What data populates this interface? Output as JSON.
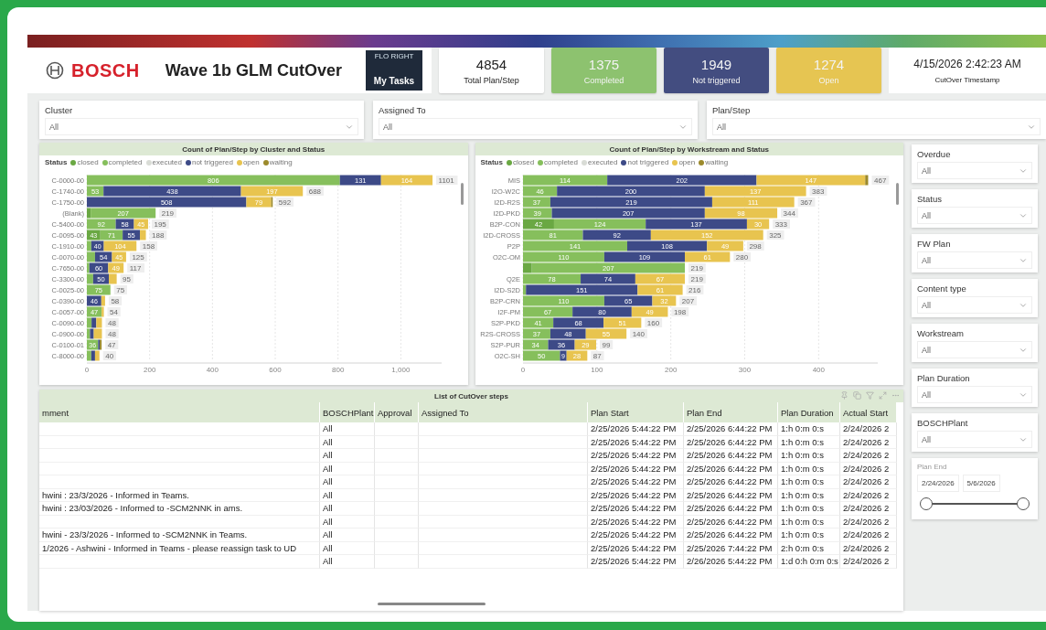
{
  "header": {
    "brand": "BOSCH",
    "title": "Wave 1b GLM CutOver",
    "tile": {
      "logo_text": "FLO RIGHT",
      "button": "My Tasks"
    }
  },
  "kpis": [
    {
      "value": "4854",
      "label": "Total Plan/Step",
      "color": "#ffffff"
    },
    {
      "value": "1375",
      "label": "Completed",
      "color": "#8dc26f"
    },
    {
      "value": "1949",
      "label": "Not triggered",
      "color": "#434d80"
    },
    {
      "value": "1274",
      "label": "Open",
      "color": "#e6c552"
    }
  ],
  "timestamp": {
    "value": "4/15/2026 2:42:23 AM",
    "label": "CutOver Timestamp"
  },
  "filters": [
    {
      "label": "Cluster",
      "value": "All"
    },
    {
      "label": "Assigned To",
      "value": "All"
    },
    {
      "label": "Plan/Step",
      "value": "All"
    }
  ],
  "charts": [
    {
      "legend_title": "Status",
      "totals": [
        "1101",
        "688",
        "592",
        "219",
        "195",
        "188",
        "158",
        "125",
        "117",
        "95",
        "75",
        "58",
        "54",
        "48",
        "48",
        "47",
        "40"
      ],
      "chart_data": {
        "type": "bar",
        "orientation": "horizontal",
        "stacked": true,
        "grid": true,
        "title": "Count of Plan/Step by Cluster and Status",
        "categories": [
          "C-0000-00",
          "C-1740-00",
          "C-1750-00",
          "(Blank)",
          "C-5400-00",
          "C-0095-00",
          "C-1910-00",
          "C-0070-00",
          "C-7650-00",
          "C-3300-00",
          "C-0025-00",
          "C-0390-00",
          "C-0057-00",
          "C-0090-00",
          "C-0900-00",
          "C-0100-01",
          "C-8000-00"
        ],
        "xlim": [
          0,
          1130
        ],
        "xticks": [
          0,
          200,
          400,
          600,
          800,
          {
            "value": 1000,
            "label": "1,000"
          }
        ],
        "series": [
          {
            "name": "closed",
            "color": "#6aa843",
            "values": [
              null,
              null,
              null,
              12,
              null,
              43,
              null,
              null,
              null,
              null,
              null,
              null,
              null,
              null,
              null,
              null,
              null
            ],
            "value_labels": [
              null,
              null,
              null,
              null,
              null,
              "43",
              null,
              null,
              null,
              null,
              null,
              null,
              null,
              null,
              null,
              null,
              null
            ]
          },
          {
            "name": "completed",
            "color": "#86bf5c",
            "values": [
              806,
              53,
              null,
              207,
              92,
              71,
              14,
              26,
              8,
              20,
              75,
              null,
              47,
              15,
              10,
              36,
              14
            ],
            "value_labels": [
              "806",
              "53",
              null,
              "207",
              "92",
              "71",
              null,
              null,
              null,
              null,
              "75",
              null,
              "47",
              null,
              null,
              "36",
              null
            ]
          },
          {
            "name": "executed",
            "color": "#d9dcd6",
            "values": [
              null,
              null,
              null,
              null,
              null,
              null,
              null,
              null,
              null,
              null,
              null,
              null,
              null,
              null,
              null,
              null,
              null
            ],
            "value_labels": [
              null,
              null,
              null,
              null,
              null,
              null,
              null,
              null,
              null,
              null,
              null,
              null,
              null,
              null,
              null,
              null,
              null
            ]
          },
          {
            "name": "not triggered",
            "color": "#3d4a87",
            "values": [
              131,
              438,
              508,
              null,
              58,
              55,
              40,
              54,
              60,
              50,
              null,
              46,
              null,
              15,
              12,
              5,
              12
            ],
            "value_labels": [
              "131",
              "438",
              "508",
              null,
              "58",
              "55",
              "40",
              "54",
              "60",
              "50",
              null,
              "46",
              null,
              null,
              null,
              null,
              null
            ]
          },
          {
            "name": "open",
            "color": "#e8c44f",
            "values": [
              164,
              197,
              79,
              null,
              45,
              19,
              104,
              45,
              49,
              25,
              null,
              12,
              7,
              18,
              26,
              null,
              14
            ],
            "value_labels": [
              "164",
              "197",
              "79",
              null,
              "45",
              null,
              "104",
              "45",
              "49",
              null,
              null,
              null,
              null,
              null,
              null,
              null,
              null
            ]
          },
          {
            "name": "waiting",
            "color": "#9c8a2c",
            "values": [
              null,
              null,
              5,
              null,
              null,
              null,
              null,
              null,
              null,
              null,
              null,
              null,
              null,
              null,
              null,
              6,
              null
            ],
            "value_labels": [
              null,
              null,
              null,
              null,
              null,
              null,
              null,
              null,
              null,
              null,
              null,
              null,
              null,
              null,
              null,
              null,
              null
            ]
          }
        ]
      }
    },
    {
      "legend_title": "Status",
      "totals": [
        "467",
        "383",
        "367",
        "344",
        "333",
        "325",
        "298",
        "280",
        "219",
        "219",
        "216",
        "207",
        "198",
        "160",
        "140",
        "99",
        "87"
      ],
      "chart_data": {
        "type": "bar",
        "orientation": "horizontal",
        "stacked": true,
        "grid": true,
        "title": "Count of Plan/Step by Workstream and Status",
        "categories": [
          "MIS",
          "I2O-W2C",
          "I2D-R2S",
          "I2D-PKD",
          "B2P-CON",
          "I2D-CROSS",
          "P2P",
          "O2C-OM",
          null,
          "Q2E",
          "I2D-S2D",
          "B2P-CRN",
          "I2F-PM",
          "S2P-PKD",
          "R2S-CROSS",
          "S2P-PUR",
          "O2C-SH"
        ],
        "xlim": [
          0,
          480
        ],
        "xticks": [
          0,
          100,
          200,
          300,
          400
        ],
        "series": [
          {
            "name": "closed",
            "color": "#6aa843",
            "values": [
              null,
              null,
              null,
              null,
              42,
              null,
              null,
              null,
              12,
              null,
              null,
              null,
              null,
              null,
              null,
              null,
              null
            ],
            "value_labels": [
              null,
              null,
              null,
              null,
              "42",
              null,
              null,
              null,
              null,
              null,
              null,
              null,
              null,
              null,
              null,
              null,
              null
            ]
          },
          {
            "name": "completed",
            "color": "#86bf5c",
            "values": [
              114,
              46,
              37,
              39,
              124,
              81,
              141,
              110,
              207,
              78,
              4,
              110,
              67,
              41,
              37,
              34,
              50
            ],
            "value_labels": [
              "114",
              "46",
              "37",
              "39",
              "124",
              "81",
              "141",
              "110",
              "207",
              "78",
              null,
              "110",
              "67",
              "41",
              "37",
              "34",
              "50"
            ]
          },
          {
            "name": "executed",
            "color": "#d9dcd6",
            "values": [
              null,
              null,
              null,
              null,
              null,
              null,
              null,
              null,
              null,
              null,
              null,
              null,
              null,
              null,
              null,
              null,
              null
            ],
            "value_labels": [
              null,
              null,
              null,
              null,
              null,
              null,
              null,
              null,
              null,
              null,
              null,
              null,
              null,
              null,
              null,
              null,
              null
            ]
          },
          {
            "name": "not triggered",
            "color": "#3d4a87",
            "values": [
              202,
              200,
              219,
              207,
              137,
              92,
              108,
              109,
              null,
              74,
              151,
              65,
              80,
              68,
              48,
              36,
              9
            ],
            "value_labels": [
              "202",
              "200",
              "219",
              "207",
              "137",
              "92",
              "108",
              "109",
              null,
              "74",
              "151",
              "65",
              "80",
              "68",
              "48",
              "36",
              "9"
            ]
          },
          {
            "name": "open",
            "color": "#e8c44f",
            "values": [
              147,
              137,
              111,
              98,
              30,
              152,
              49,
              61,
              null,
              67,
              61,
              32,
              49,
              51,
              55,
              29,
              28
            ],
            "value_labels": [
              "147",
              "137",
              "111",
              "98",
              "30",
              "152",
              "49",
              "61",
              null,
              "67",
              "61",
              "32",
              "49",
              "51",
              "55",
              "29",
              "28"
            ]
          },
          {
            "name": "waiting",
            "color": "#9c8a2c",
            "values": [
              4,
              null,
              null,
              null,
              null,
              null,
              null,
              null,
              null,
              null,
              null,
              null,
              null,
              null,
              null,
              null,
              null
            ],
            "value_labels": [
              null,
              null,
              null,
              null,
              null,
              null,
              null,
              null,
              null,
              null,
              null,
              null,
              null,
              null,
              null,
              null,
              null
            ]
          }
        ]
      }
    }
  ],
  "side_filters": [
    {
      "label": "Overdue",
      "value": "All"
    },
    {
      "label": "Status",
      "value": "All"
    },
    {
      "label": "FW Plan",
      "value": "All"
    },
    {
      "label": "Content type",
      "value": "All"
    },
    {
      "label": "Workstream",
      "value": "All"
    },
    {
      "label": "Plan Duration",
      "value": "All"
    },
    {
      "label": "BOSCHPlant",
      "value": "All"
    }
  ],
  "date_range": {
    "label": "Plan End",
    "start": "2/24/2026",
    "end": "5/6/2026",
    "level": 1
  },
  "table": {
    "title": "List of CutOver steps",
    "columns": [
      "mment",
      "BOSCHPlant",
      "Approval",
      "Assigned To",
      "Plan Start",
      "Plan End",
      "Plan Duration",
      "Actual Start"
    ],
    "rows": [
      [
        null,
        "All",
        null,
        null,
        "2/25/2026 5:44:22 PM",
        "2/25/2026 6:44:22 PM",
        "1:h 0:m 0:s",
        "2/24/2026 2"
      ],
      [
        null,
        "All",
        null,
        null,
        "2/25/2026 5:44:22 PM",
        "2/25/2026 6:44:22 PM",
        "1:h 0:m 0:s",
        "2/24/2026 2"
      ],
      [
        null,
        "All",
        null,
        null,
        "2/25/2026 5:44:22 PM",
        "2/25/2026 6:44:22 PM",
        "1:h 0:m 0:s",
        "2/24/2026 2"
      ],
      [
        null,
        "All",
        null,
        null,
        "2/25/2026 5:44:22 PM",
        "2/25/2026 6:44:22 PM",
        "1:h 0:m 0:s",
        "2/24/2026 2"
      ],
      [
        null,
        "All",
        null,
        null,
        "2/25/2026 5:44:22 PM",
        "2/25/2026 6:44:22 PM",
        "1:h 0:m 0:s",
        "2/24/2026 2"
      ],
      [
        "hwini : 23/3/2026 - Informed in Teams.",
        "All",
        null,
        null,
        "2/25/2026 5:44:22 PM",
        "2/25/2026 6:44:22 PM",
        "1:h 0:m 0:s",
        "2/24/2026 2"
      ],
      [
        "hwini : 23/03/2026 - Informed to -SCM2NNK in ams.",
        "All",
        null,
        null,
        "2/25/2026 5:44:22 PM",
        "2/25/2026 6:44:22 PM",
        "1:h 0:m 0:s",
        "2/24/2026 2"
      ],
      [
        null,
        "All",
        null,
        null,
        "2/25/2026 5:44:22 PM",
        "2/25/2026 6:44:22 PM",
        "1:h 0:m 0:s",
        "2/24/2026 2"
      ],
      [
        "hwini - 23/3/2026 - Informed to -SCM2NNK in Teams.",
        "All",
        null,
        null,
        "2/25/2026 5:44:22 PM",
        "2/25/2026 6:44:22 PM",
        "1:h 0:m 0:s",
        "2/24/2026 2"
      ],
      [
        "1/2026 - Ashwini - Informed in Teams - please reassign task to UD",
        "All",
        null,
        null,
        "2/25/2026 5:44:22 PM",
        "2/25/2026 7:44:22 PM",
        "2:h 0:m 0:s",
        "2/24/2026 2"
      ],
      [
        null,
        "All",
        null,
        null,
        "2/25/2026 5:44:22 PM",
        "2/26/2026 5:44:22 PM",
        "1:d 0:h 0:m 0:s",
        "2/24/2026 2"
      ]
    ]
  }
}
